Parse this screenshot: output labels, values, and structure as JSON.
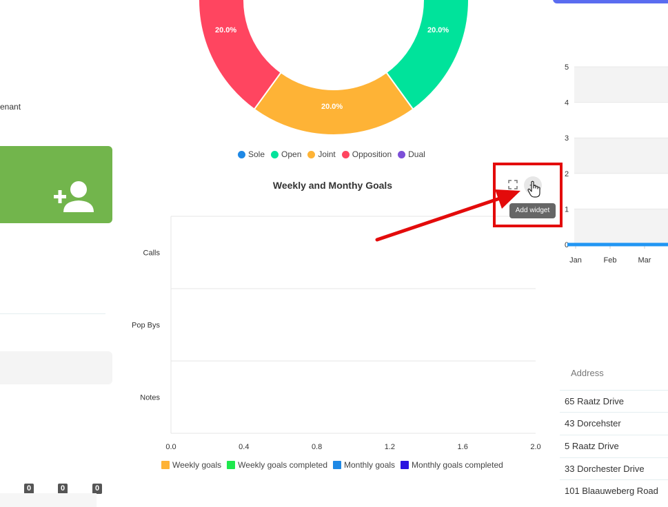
{
  "left": {
    "tenant_fragment": "enant",
    "counts": [
      "0",
      "0",
      "0"
    ]
  },
  "donut": {
    "slice_labels": [
      "20.0%",
      "20.0%",
      "20.0%"
    ],
    "legend": [
      {
        "label": "Sole",
        "color": "#1e88e5"
      },
      {
        "label": "Open",
        "color": "#00e39b"
      },
      {
        "label": "Joint",
        "color": "#feb336"
      },
      {
        "label": "Opposition",
        "color": "#ff4560"
      },
      {
        "label": "Dual",
        "color": "#7c4fd8"
      }
    ]
  },
  "goals_widget": {
    "title": "Weekly and Monthy Goals",
    "tooltip": "Add widget",
    "expand_icon": "expand-icon",
    "add_icon": "plus-icon"
  },
  "chart_data": [
    {
      "type": "bar",
      "orientation": "horizontal",
      "title": "Weekly and Monthy Goals",
      "categories": [
        "Calls",
        "Pop Bys",
        "Notes"
      ],
      "x_ticks": [
        "0.0",
        "0.4",
        "0.8",
        "1.2",
        "1.6",
        "2.0"
      ],
      "xlim": [
        0,
        2
      ],
      "series": [
        {
          "name": "Weekly goals",
          "color": "#feb336",
          "values": [
            0,
            0,
            0
          ]
        },
        {
          "name": "Weekly goals completed",
          "color": "#1ee84d",
          "values": [
            0,
            0,
            0
          ]
        },
        {
          "name": "Monthly goals",
          "color": "#1e88e5",
          "values": [
            0,
            0,
            0
          ]
        },
        {
          "name": "Monthly goals completed",
          "color": "#2b13e0",
          "values": [
            0,
            0,
            0
          ]
        }
      ],
      "legend_position": "bottom"
    },
    {
      "type": "pie",
      "donut": true,
      "labels": [
        "Sole",
        "Open",
        "Joint",
        "Opposition",
        "Dual"
      ],
      "values": [
        20,
        20,
        20,
        20,
        20
      ],
      "colors": [
        "#1e88e5",
        "#00e39b",
        "#feb336",
        "#ff4560",
        "#7c4fd8"
      ],
      "legend_position": "bottom"
    },
    {
      "type": "line",
      "categories": [
        "Jan",
        "Feb",
        "Mar"
      ],
      "y_ticks": [
        "5",
        "4",
        "3",
        "2",
        "1",
        "0"
      ],
      "ylim": [
        0,
        5
      ],
      "series": [
        {
          "color": "#2196f3",
          "values": [
            0,
            0,
            0
          ]
        }
      ]
    }
  ],
  "address_table": {
    "header": "Address",
    "rows": [
      "65 Raatz Drive",
      "43 Dorcehster",
      "5 Raatz Drive",
      "33 Dorchester Drive",
      "101 Blaauweberg Road"
    ]
  },
  "colors": {
    "add_user_card": "#72b54c",
    "highlight": "#e30b0b",
    "tooltip_bg": "#666666",
    "top_right_button": "#5a6cf0"
  },
  "icons": {
    "add_user": "add-user-icon",
    "cursor": "hand-cursor-icon"
  }
}
